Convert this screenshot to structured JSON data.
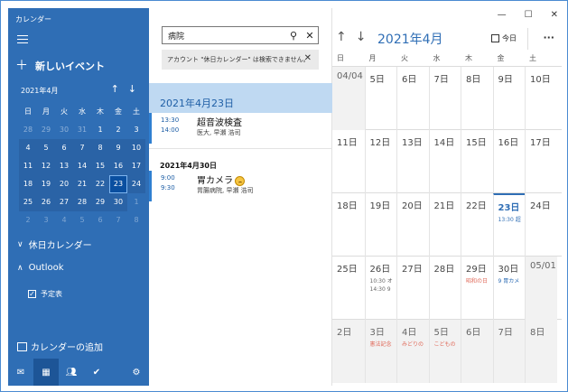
{
  "app": {
    "title": "カレンダー"
  },
  "sidebar": {
    "new_event": "新しいイベント",
    "mini_month": "2021年4月",
    "dow": [
      "日",
      "月",
      "火",
      "水",
      "木",
      "金",
      "土"
    ],
    "weeks": [
      [
        "28",
        "29",
        "30",
        "31",
        "1",
        "2",
        "3"
      ],
      [
        "4",
        "5",
        "6",
        "7",
        "8",
        "9",
        "10"
      ],
      [
        "11",
        "12",
        "13",
        "14",
        "15",
        "16",
        "17"
      ],
      [
        "18",
        "19",
        "20",
        "21",
        "22",
        "23",
        "24"
      ],
      [
        "25",
        "26",
        "27",
        "28",
        "29",
        "30",
        "1"
      ],
      [
        "2",
        "3",
        "4",
        "5",
        "6",
        "7",
        "8"
      ]
    ],
    "holiday_calendar": "休日カレンダー",
    "outlook": "Outlook",
    "calendar_item": "予定表",
    "add_calendar": "カレンダーの追加"
  },
  "search": {
    "value": "病院",
    "notice": "アカウント \"休日カレンダー\" は検索できません。"
  },
  "results": {
    "date1": "2021年4月23日",
    "event1": {
      "start": "13:30",
      "end": "14:00",
      "title": "超音波検査",
      "sub": "医大, 早瀬 浩司"
    },
    "date2": "2021年4月30日",
    "event2": {
      "start": "9:00",
      "end": "9:30",
      "title": "胃カメラ",
      "sub": "胃腸病院, 早瀬 浩司"
    }
  },
  "calendar": {
    "month_title": "2021年4月",
    "today_label": "今日",
    "dow": [
      "日",
      "月",
      "火",
      "水",
      "木",
      "金",
      "土"
    ],
    "rows": [
      [
        {
          "d": "04/04"
        },
        {
          "d": "5日"
        },
        {
          "d": "6日"
        },
        {
          "d": "7日"
        },
        {
          "d": "8日"
        },
        {
          "d": "9日"
        },
        {
          "d": "10日"
        }
      ],
      [
        {
          "d": "11日"
        },
        {
          "d": "12日"
        },
        {
          "d": "13日"
        },
        {
          "d": "14日"
        },
        {
          "d": "15日"
        },
        {
          "d": "16日"
        },
        {
          "d": "17日"
        }
      ],
      [
        {
          "d": "18日"
        },
        {
          "d": "19日"
        },
        {
          "d": "20日"
        },
        {
          "d": "21日"
        },
        {
          "d": "22日"
        },
        {
          "d": "23日",
          "e1": "13:30 超"
        },
        {
          "d": "24日"
        }
      ],
      [
        {
          "d": "25日"
        },
        {
          "d": "26日",
          "e1": "10:30 オ",
          "e2": "14:30 9"
        },
        {
          "d": "27日"
        },
        {
          "d": "28日"
        },
        {
          "d": "29日",
          "e1": "昭和の日"
        },
        {
          "d": "30日",
          "e1": "9 胃カメ"
        },
        {
          "d": "05/01"
        }
      ],
      [
        {
          "d": "2日"
        },
        {
          "d": "3日",
          "e1": "憲法記念"
        },
        {
          "d": "4日",
          "e1": "みどりの"
        },
        {
          "d": "5日",
          "e1": "こどもの"
        },
        {
          "d": "6日"
        },
        {
          "d": "7日"
        },
        {
          "d": "8日"
        }
      ]
    ]
  },
  "colors": {
    "accent": "#2f6eb5",
    "sidebar": "#2f6eb5",
    "selection": "#bfd9f2",
    "holiday": "#e06a5a"
  }
}
